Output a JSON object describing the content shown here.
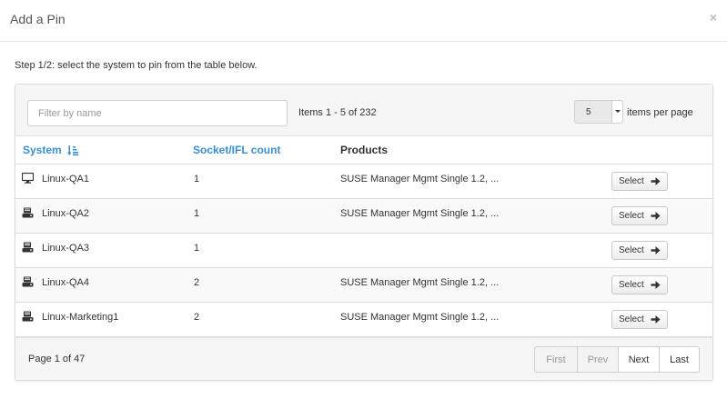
{
  "modal": {
    "title": "Add a Pin",
    "close_glyph": "×"
  },
  "step_text": "Step 1/2: select the system to pin from the table below.",
  "filter": {
    "placeholder": "Filter by name",
    "value": ""
  },
  "items_count": "Items 1 - 5 of 232",
  "per_page": {
    "value": "5",
    "label": "items per page"
  },
  "table": {
    "columns": [
      {
        "label": "System",
        "sortable": true,
        "sort_icon": "sort-alpha-asc-icon"
      },
      {
        "label": "Socket/IFL count",
        "sortable": true
      },
      {
        "label": "Products",
        "sortable": false
      }
    ],
    "rows": [
      {
        "system": "Linux-QA1",
        "icon": "desktop-icon",
        "count": "1",
        "products": "SUSE Manager Mgmt Single 1.2, ...",
        "action": "Select"
      },
      {
        "system": "Linux-QA2",
        "icon": "server-icon",
        "count": "1",
        "products": "SUSE Manager Mgmt Single 1.2, ...",
        "action": "Select"
      },
      {
        "system": "Linux-QA3",
        "icon": "server-icon",
        "count": "1",
        "products": "",
        "action": "Select"
      },
      {
        "system": "Linux-QA4",
        "icon": "server-icon",
        "count": "2",
        "products": "SUSE Manager Mgmt Single 1.2, ...",
        "action": "Select"
      },
      {
        "system": "Linux-Marketing1",
        "icon": "server-icon",
        "count": "2",
        "products": "SUSE Manager Mgmt Single 1.2, ...",
        "action": "Select"
      }
    ]
  },
  "footer": {
    "page_info": "Page 1 of 47",
    "pager": {
      "first": "First",
      "prev": "Prev",
      "next": "Next",
      "last": "Last"
    }
  },
  "colors": {
    "link": "#3a8ed0",
    "panel_bg": "#f5f5f5",
    "border": "#dddddd"
  }
}
